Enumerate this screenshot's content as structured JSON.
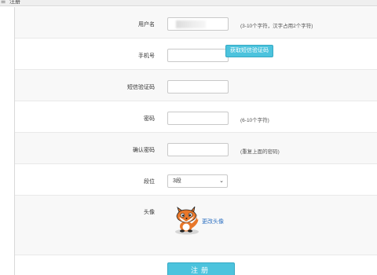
{
  "header": {
    "title": "注册",
    "icon": "list-icon"
  },
  "form": {
    "username": {
      "label": "用户名",
      "value": "",
      "hint": "(3-10个字符，汉字占用2个字符)"
    },
    "phone": {
      "label": "手机号",
      "value": "",
      "button": "获取短信验证码"
    },
    "sms_code": {
      "label": "短信验证码",
      "value": ""
    },
    "password": {
      "label": "密码",
      "value": "",
      "hint": "(6-10个字符)"
    },
    "confirm_password": {
      "label": "确认密码",
      "value": "",
      "hint": "(重复上面的密码)"
    },
    "level": {
      "label": "段位",
      "selected": "3段"
    },
    "avatar": {
      "label": "头像",
      "change_link": "更改头像"
    },
    "submit": {
      "label": "注册"
    }
  },
  "colors": {
    "accent": "#4cc3dd",
    "link": "#2b6fc1"
  }
}
